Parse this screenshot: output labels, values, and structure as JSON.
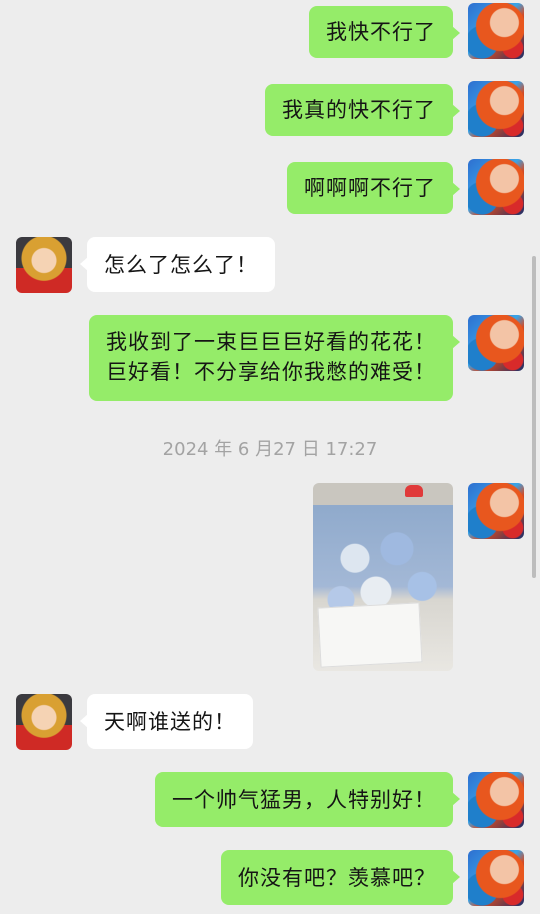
{
  "messages": {
    "m1": "我快不行了",
    "m2": "我真的快不行了",
    "m3": "啊啊啊不行了",
    "m4": "怎么了怎么了！",
    "m5_line1": "我收到了一束巨巨巨好看的花花！",
    "m5_line2": "巨好看！不分享给你我憋的难受！",
    "timestamp": "2024 年 6 月27 日 17:27",
    "m7": "天啊谁送的！",
    "m8": "一个帅气猛男，人特别好！",
    "m9": "你没有吧？羡慕吧？"
  },
  "colors": {
    "sent_bubble": "#95ec69",
    "received_bubble": "#ffffff",
    "background": "#ededed",
    "timestamp_text": "#a3a3a3"
  }
}
